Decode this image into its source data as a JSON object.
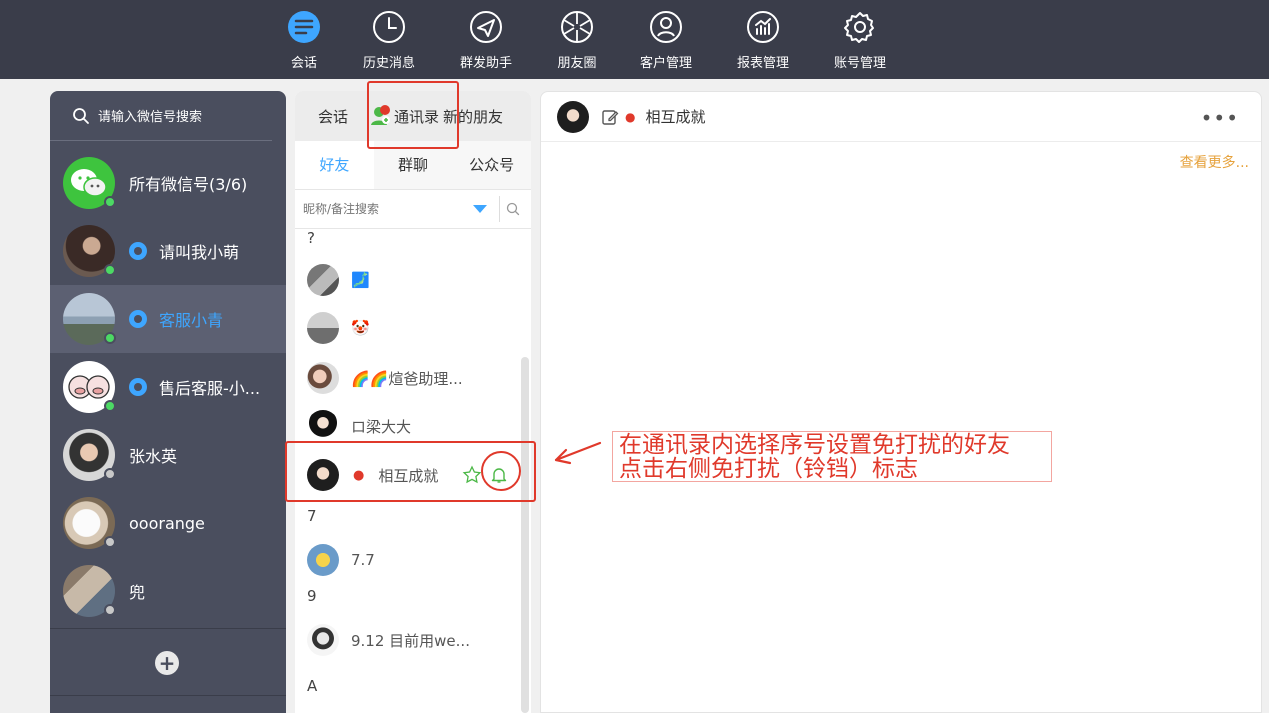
{
  "nav": {
    "items": [
      {
        "label": "会话",
        "icon": "chat-bubble-icon",
        "active": true
      },
      {
        "label": "历史消息",
        "icon": "clock-icon"
      },
      {
        "label": "群发助手",
        "icon": "paper-plane-icon"
      },
      {
        "label": "朋友圈",
        "icon": "aperture-icon"
      },
      {
        "label": "客户管理",
        "icon": "person-icon"
      },
      {
        "label": "报表管理",
        "icon": "chart-icon"
      },
      {
        "label": "账号管理",
        "icon": "gear-icon"
      }
    ]
  },
  "accounts": {
    "search_placeholder": "请输入微信号搜索",
    "items": [
      {
        "name": "所有微信号(3/6)",
        "status": "online"
      },
      {
        "name": "请叫我小萌",
        "status": "online",
        "ring": true
      },
      {
        "name": "客服小青",
        "status": "online",
        "ring": true,
        "selected": true
      },
      {
        "name": "售后客服-小...",
        "status": "online",
        "ring": true
      },
      {
        "name": "张水英",
        "status": "offline"
      },
      {
        "name": "ooorange",
        "status": "offline"
      },
      {
        "name": "兜",
        "status": "offline"
      }
    ],
    "add_label": "+"
  },
  "contacts": {
    "top_tabs": [
      "会话",
      "通讯录",
      "新的朋友"
    ],
    "sub_tabs": [
      "好友",
      "群聊",
      "公众号"
    ],
    "search_placeholder": "昵称/备注搜索",
    "groups": [
      {
        "letter": "?",
        "items": [
          "🗾",
          "🤡",
          "🌈🌈煊爸助理...",
          "ロ梁大大",
          "相互成就"
        ]
      },
      {
        "letter": "7",
        "items": [
          "7.7"
        ]
      },
      {
        "letter": "9",
        "items": [
          "9.12 目前用we..."
        ]
      },
      {
        "letter": "A",
        "items": []
      }
    ]
  },
  "chat": {
    "title": "相互成就",
    "more": "•••",
    "see_more": "查看更多..."
  },
  "annotation": {
    "line1": "在通讯录内选择序号设置免打扰的好友",
    "line2": "点击右侧免打扰（铃铛）标志"
  },
  "colors": {
    "accent": "#3ea6ff",
    "annotation": "#e0392b",
    "topbar": "#3a3d4a",
    "sidebar": "#4a4e5e"
  }
}
